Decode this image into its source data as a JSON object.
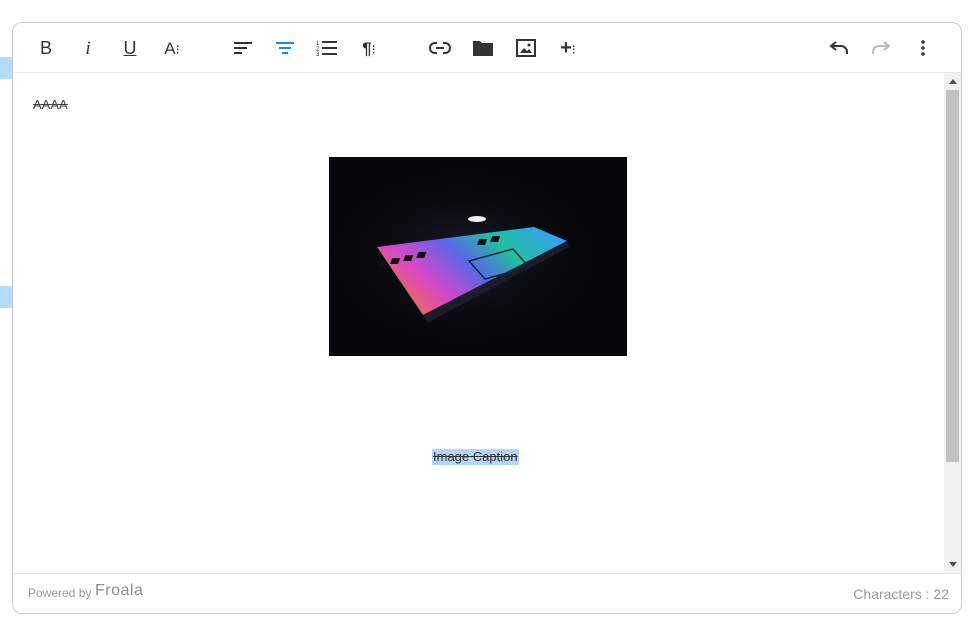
{
  "toolbar": {
    "bold_label": "B",
    "italic_label": "i",
    "underline_label": "U",
    "text_format_label": "A",
    "active_color": "#1e88e5",
    "icons": [
      "bold-icon",
      "italic-icon",
      "underline-icon",
      "text-format-icon",
      "align-left-icon",
      "align-center-icon",
      "ordered-list-icon",
      "paragraph-format-icon",
      "link-icon",
      "folder-icon",
      "image-icon",
      "more-insert-icon",
      "undo-icon",
      "redo-icon",
      "more-vertical-icon"
    ]
  },
  "content": {
    "paragraph": "AAAA",
    "caption": "Image Caption"
  },
  "footer": {
    "powered_by": "Powered by",
    "brand": "Froala",
    "char_count": "Characters : 22"
  },
  "colors": {
    "selection": "#b5d5f8",
    "border": "#cccccc"
  }
}
